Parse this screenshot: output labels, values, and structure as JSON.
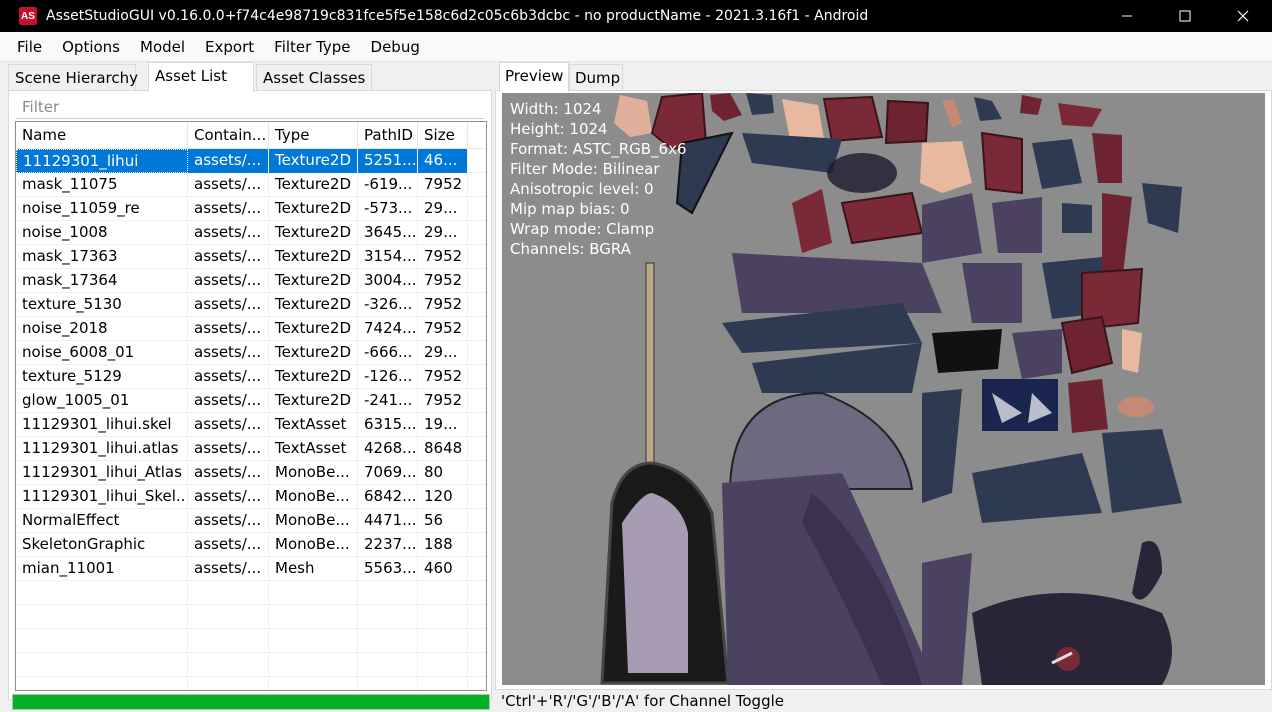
{
  "window": {
    "title": "AssetStudioGUI v0.16.0.0+f74c4e98719c831fce5f5e158c6d2c05c6b3dcbc - no productName - 2021.3.16f1 - Android",
    "icon_text": "AS",
    "controls": [
      "minimize-icon",
      "maximize-icon",
      "close-icon"
    ]
  },
  "menu": [
    "File",
    "Options",
    "Model",
    "Export",
    "Filter Type",
    "Debug"
  ],
  "left_tabs": [
    "Scene Hierarchy",
    "Asset List",
    "Asset Classes"
  ],
  "active_left_tab": "Asset List",
  "filter": {
    "placeholder": "Filter"
  },
  "asset_list": {
    "columns": [
      "Name",
      "Contain...",
      "Type",
      "PathID",
      "Size"
    ],
    "rows": [
      [
        "11129301_lihui",
        "assets/...",
        "Texture2D",
        "5251...",
        "46..."
      ],
      [
        "mask_11075",
        "assets/...",
        "Texture2D",
        "-619...",
        "7952"
      ],
      [
        "noise_11059_re",
        "assets/...",
        "Texture2D",
        "-573...",
        "29..."
      ],
      [
        "noise_1008",
        "assets/...",
        "Texture2D",
        "3645...",
        "29..."
      ],
      [
        "mask_17363",
        "assets/...",
        "Texture2D",
        "3154...",
        "7952"
      ],
      [
        "mask_17364",
        "assets/...",
        "Texture2D",
        "3004...",
        "7952"
      ],
      [
        "texture_5130",
        "assets/...",
        "Texture2D",
        "-326...",
        "7952"
      ],
      [
        "noise_2018",
        "assets/...",
        "Texture2D",
        "7424...",
        "7952"
      ],
      [
        "noise_6008_01",
        "assets/...",
        "Texture2D",
        "-666...",
        "29..."
      ],
      [
        "texture_5129",
        "assets/...",
        "Texture2D",
        "-126...",
        "7952"
      ],
      [
        "glow_1005_01",
        "assets/...",
        "Texture2D",
        "-241...",
        "7952"
      ],
      [
        "11129301_lihui.skel",
        "assets/...",
        "TextAsset",
        "6315...",
        "19..."
      ],
      [
        "11129301_lihui.atlas",
        "assets/...",
        "TextAsset",
        "4268...",
        "8648"
      ],
      [
        "11129301_lihui_Atlas",
        "assets/...",
        "MonoBe...",
        "7069...",
        "80"
      ],
      [
        "11129301_lihui_Skel...",
        "assets/...",
        "MonoBe...",
        "6842...",
        "120"
      ],
      [
        "NormalEffect",
        "assets/...",
        "MonoBe...",
        "4471...",
        "56"
      ],
      [
        "SkeletonGraphic",
        "assets/...",
        "MonoBe...",
        "2237...",
        "188"
      ],
      [
        "mian_11001",
        "assets/...",
        "Mesh",
        "5563...",
        "460"
      ]
    ],
    "selected_index": 0
  },
  "progress": {
    "value": 1.0,
    "color": "#06b025"
  },
  "right_tabs": [
    "Preview",
    "Dump"
  ],
  "active_right_tab": "Preview",
  "preview_info": [
    "Width: 1024",
    "Height: 1024",
    "Format: ASTC_RGB_6x6",
    "Filter Mode: Bilinear",
    "Anisotropic level: 0",
    "Mip map bias: 0",
    "Wrap mode: Clamp",
    "Channels: BGRA"
  ],
  "status_text": "'Ctrl'+'R'/'G'/'B'/'A' for Channel Toggle",
  "colors": {
    "selection": "#0078d7",
    "preview_bg": "#8c8c8c",
    "texture_red": "#7a2a36",
    "texture_navy": "#2e3a52",
    "texture_purple": "#4a4260",
    "texture_skin": "#e8b8a0"
  }
}
